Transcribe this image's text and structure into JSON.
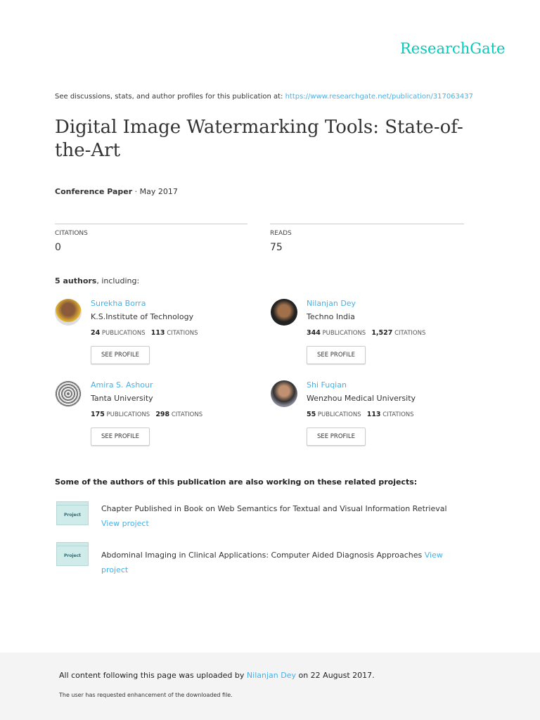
{
  "logo": "ResearchGate",
  "discussion": {
    "text": "See discussions, stats, and author profiles for this publication at: ",
    "url": "https://www.researchgate.net/publication/317063437"
  },
  "title": "Digital Image Watermarking Tools: State-of-the-Art",
  "pub_type": "Conference Paper",
  "pub_date": " · May 2017",
  "stats": {
    "citations_label": "CITATIONS",
    "citations": "0",
    "reads_label": "READS",
    "reads": "75"
  },
  "authors_heading": {
    "count": "5 authors",
    "suffix": ", including:"
  },
  "authors": [
    {
      "name": "Surekha Borra",
      "inst": "K.S.Institute of Technology",
      "pubs": "24",
      "cites": "113"
    },
    {
      "name": "Nilanjan Dey",
      "inst": "Techno India",
      "pubs": "344",
      "cites": "1,527"
    },
    {
      "name": "Amira S. Ashour",
      "inst": "Tanta University",
      "pubs": "175",
      "cites": "298"
    },
    {
      "name": "Shi Fuqian",
      "inst": "Wenzhou Medical University",
      "pubs": "55",
      "cites": "113"
    }
  ],
  "labels": {
    "publications": " PUBLICATIONS",
    "citations": " CITATIONS",
    "see_profile": "SEE PROFILE",
    "project": "Project",
    "view_project": "View project"
  },
  "related_heading": "Some of the authors of this publication are also working on these related projects:",
  "projects": [
    {
      "title": "Chapter Published in Book on Web Semantics for Textual and Visual Information Retrieval "
    },
    {
      "title": "Abdominal Imaging in Clinical Applications: Computer Aided Diagnosis Approaches "
    }
  ],
  "footer": {
    "prefix": "All content following this page was uploaded by ",
    "uploader": "Nilanjan Dey",
    "suffix": " on 22 August 2017.",
    "note": "The user has requested enhancement of the downloaded file."
  }
}
